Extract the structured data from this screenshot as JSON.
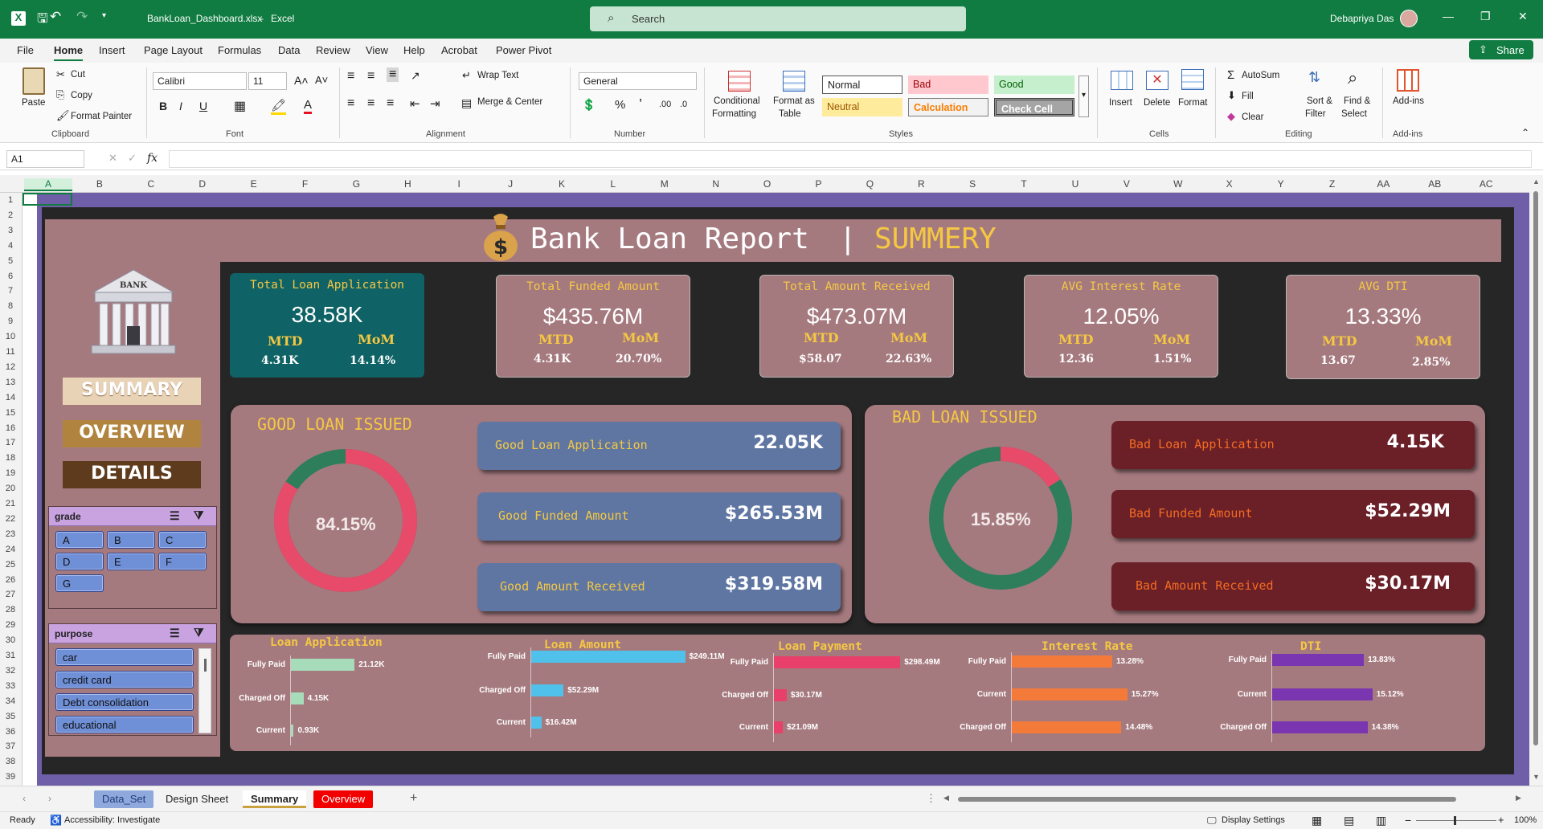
{
  "titlebar": {
    "file": "BankLoan_Dashboard.xlsx",
    "sep": "-",
    "app": "Excel",
    "search": "Search",
    "user": "Debapriya Das"
  },
  "menu": [
    "File",
    "Home",
    "Insert",
    "Page Layout",
    "Formulas",
    "Data",
    "Review",
    "View",
    "Help",
    "Acrobat",
    "Power Pivot"
  ],
  "share": "Share",
  "ribbon": {
    "paste": "Paste",
    "cut": "Cut",
    "copy": "Copy",
    "format_painter": "Format Painter",
    "clipboard": "Clipboard",
    "font_name": "Calibri",
    "font_size": "11",
    "font": "Font",
    "wrap": "Wrap Text",
    "merge": "Merge & Center",
    "alignment": "Alignment",
    "numfmt": "General",
    "number": "Number",
    "cond1": "Conditional",
    "cond2": "Formatting",
    "fmt1": "Format as",
    "fmt2": "Table",
    "styles": [
      "Normal",
      "Bad",
      "Good",
      "Neutral",
      "Calculation",
      "Check Cell"
    ],
    "styles_group": "Styles",
    "insert": "Insert",
    "delete": "Delete",
    "format": "Format",
    "cells": "Cells",
    "autosum": "AutoSum",
    "fill": "Fill",
    "clear": "Clear",
    "sort1": "Sort &",
    "sort2": "Filter",
    "find1": "Find &",
    "find2": "Select",
    "editing": "Editing",
    "addins": "Add-ins",
    "addins_group": "Add-ins"
  },
  "formula": {
    "namebox": "A1",
    "fx": "fx"
  },
  "columns": [
    "A",
    "B",
    "C",
    "D",
    "E",
    "F",
    "G",
    "H",
    "I",
    "J",
    "K",
    "L",
    "M",
    "N",
    "O",
    "P",
    "Q",
    "R",
    "S",
    "T",
    "U",
    "V",
    "W",
    "X",
    "Y",
    "Z",
    "AA",
    "AB",
    "AC"
  ],
  "rows": [
    "1",
    "2",
    "3",
    "4",
    "5",
    "6",
    "7",
    "8",
    "9",
    "10",
    "11",
    "12",
    "13",
    "14",
    "15",
    "16",
    "17",
    "18",
    "19",
    "20",
    "21",
    "22",
    "23",
    "24",
    "25",
    "26",
    "27",
    "28",
    "29",
    "30",
    "31",
    "32",
    "33",
    "34",
    "35",
    "36",
    "37",
    "38",
    "39"
  ],
  "dashboard": {
    "title": "Bank Loan Report",
    "divider": "|",
    "subtitle": "SUMMERY",
    "bank_sign": "BANK",
    "nav": [
      "SUMMARY",
      "OVERVIEW",
      "DETAILS"
    ],
    "slicer_grade": {
      "title": "grade",
      "items": [
        "A",
        "B",
        "C",
        "D",
        "E",
        "F",
        "G"
      ]
    },
    "slicer_purpose": {
      "title": "purpose",
      "items": [
        "car",
        "credit card",
        "Debt consolidation",
        "educational"
      ]
    },
    "kpis": [
      {
        "title": "Total Loan Application",
        "value": "38.58K",
        "mtd_label": "MTD",
        "mom_label": "MoM",
        "mtd": "4.31K",
        "mom": "14.14%"
      },
      {
        "title": "Total Funded Amount",
        "value": "$435.76M",
        "mtd_label": "MTD",
        "mom_label": "MoM",
        "mtd": "4.31K",
        "mom": "20.70%"
      },
      {
        "title": "Total Amount Received",
        "value": "$473.07M",
        "mtd_label": "MTD",
        "mom_label": "MoM",
        "mtd": "$58.07",
        "mom": "22.63%"
      },
      {
        "title": "AVG Interest Rate",
        "value": "12.05%",
        "mtd_label": "MTD",
        "mom_label": "MoM",
        "mtd": "12.36",
        "mom": "1.51%"
      },
      {
        "title": "AVG DTI",
        "value": "13.33%",
        "mtd_label": "MTD",
        "mom_label": "MoM",
        "mtd": "13.67",
        "mom": "2.85%"
      }
    ],
    "good": {
      "title": "GOOD LOAN ISSUED",
      "percent": "84.15%",
      "pct_value": 84.15,
      "cards": [
        {
          "label": "Good Loan Application",
          "value": "22.05K"
        },
        {
          "label": "Good Funded Amount",
          "value": "$265.53M"
        },
        {
          "label": "Good Amount Received",
          "value": "$319.58M"
        }
      ]
    },
    "bad": {
      "title": "BAD LOAN ISSUED",
      "percent": "15.85%",
      "pct_value": 15.85,
      "cards": [
        {
          "label": "Bad Loan Application",
          "value": "4.15K"
        },
        {
          "label": "Bad Funded Amount",
          "value": "$52.29M"
        },
        {
          "label": "Bad Amount Received",
          "value": "$30.17M"
        }
      ]
    },
    "colors": {
      "rose": "#a57a7f",
      "gold": "#f5c842",
      "good_ring": "#e84a6a",
      "bad_ring": "#2e7d5b"
    }
  },
  "chart_data": [
    {
      "type": "bar",
      "title": "Loan Application",
      "categories": [
        "Fully Paid",
        "Charged Off",
        "Current"
      ],
      "labels": [
        "21.12K",
        "4.15K",
        "0.93K"
      ],
      "values": [
        21.12,
        4.15,
        0.93
      ],
      "color": "#a6dcb9"
    },
    {
      "type": "bar",
      "title": "Loan Amount",
      "categories": [
        "Fully Paid",
        "Charged Off",
        "Current"
      ],
      "labels": [
        "$249.11M",
        "$52.29M",
        "$16.42M"
      ],
      "values": [
        249.11,
        52.29,
        16.42
      ],
      "color": "#4fc1ea"
    },
    {
      "type": "bar",
      "title": "Loan Payment",
      "categories": [
        "Fully Paid",
        "Charged Off",
        "Current"
      ],
      "labels": [
        "$298.49M",
        "$30.17M",
        "$21.09M"
      ],
      "values": [
        298.49,
        30.17,
        21.09
      ],
      "color": "#e8406a"
    },
    {
      "type": "bar",
      "title": "Interest Rate",
      "categories": [
        "Fully Paid",
        "Current",
        "Charged Off"
      ],
      "labels": [
        "13.28%",
        "15.27%",
        "14.48%"
      ],
      "values": [
        13.28,
        15.27,
        14.48
      ],
      "color": "#f47a3a"
    },
    {
      "type": "bar",
      "title": "DTI",
      "categories": [
        "Fully Paid",
        "Current",
        "Charged Off"
      ],
      "labels": [
        "13.83%",
        "15.12%",
        "14.38%"
      ],
      "values": [
        13.83,
        15.12,
        14.38
      ],
      "color": "#7a35b0"
    }
  ],
  "tabs": [
    "Data_Set",
    "Design Sheet",
    "Summary",
    "Overview"
  ],
  "status": {
    "ready": "Ready",
    "accessibility": "Accessibility: Investigate",
    "display": "Display Settings",
    "zoom": "100%"
  }
}
